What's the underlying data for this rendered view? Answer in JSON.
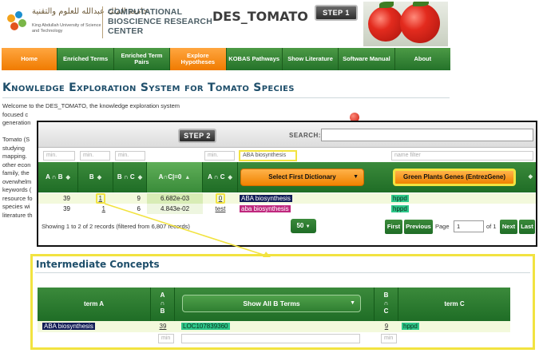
{
  "header": {
    "university_ar": "جامعة الملك عبدالله للعلوم والتقنية",
    "university_en": "King Abdullah University of Science and Technology",
    "center_line1": "COMPUTATIONAL",
    "center_line2": "BIOSCIENCE RESEARCH",
    "center_line3": "CENTER",
    "app_title": "DES_TOMATO",
    "step1_label": "STEP 1"
  },
  "nav": {
    "items": [
      {
        "label": "Home"
      },
      {
        "label": "Enriched Terms"
      },
      {
        "label": "Enriched Term Pairs"
      },
      {
        "label": "Explore Hypotheses"
      },
      {
        "label": "KOBAS Pathways"
      },
      {
        "label": "Show Literature"
      },
      {
        "label": "Software Manual"
      },
      {
        "label": "About"
      }
    ]
  },
  "page": {
    "heading": "Knowledge Exploration System for Tomato Species",
    "intro_lines": [
      "Welcome to the DES_TOMATO, the knowledge exploration system",
      "focused c",
      "generation",
      "",
      "Tomato (S",
      "studying",
      "mapping.",
      "other econ",
      "family, the",
      "overwhelm",
      "keywords (",
      "resource fo",
      "species wi",
      "literature th"
    ]
  },
  "step2": {
    "step_label": "STEP 2",
    "search_label": "SEARCH:",
    "search_value": "",
    "filters": {
      "min1": "min.",
      "min2": "min.",
      "min3": "min.",
      "min4": "min.",
      "term_filter": "ABA biosynthesis",
      "name_filter": "name filter"
    },
    "columns": {
      "a_and_b": "A ∩ B",
      "b": "B",
      "b_and_c": "B ∩ C",
      "a_c_zero": "A∩C|=0",
      "a_and_c": "A ∩ C",
      "dict1": "Select First Dictionary",
      "dict2": "Green Plants Genes (EntrezGene)"
    },
    "rows": [
      {
        "a_and_b": "39",
        "b": "1",
        "b_and_c": "9",
        "pvalue": "6.682e-03",
        "a_and_c": "0",
        "term_a": "ABA biosynthesis",
        "term_c": "hppd"
      },
      {
        "a_and_b": "39",
        "b": "1",
        "b_and_c": "6",
        "pvalue": "4.843e-02",
        "a_and_c": "test",
        "term_a": "aba biosynthesis",
        "term_c": "hppd"
      }
    ],
    "showing_text": "Showing 1 to 2 of 2 records (filtered from 6,807 records)",
    "per_page": "50",
    "pager": {
      "first": "First",
      "previous": "Previous",
      "page_label": "Page",
      "page_value": "1",
      "of_label": "of 1",
      "next": "Next",
      "last": "Last"
    }
  },
  "intermediate": {
    "title": "Intermediate Concepts",
    "columns": {
      "term_a": "term A",
      "a_and_b": "A ∩ B",
      "show_all": "Show All B Terms",
      "b_and_c": "B ∩ C",
      "term_c": "term C"
    },
    "row": {
      "term_a": "ABA biosynthesis",
      "a_and_b": "39",
      "term_b": "LOC107839360",
      "b_and_c": "9",
      "term_c": "hppd"
    },
    "filters": {
      "min1": "min",
      "min2": "min"
    }
  },
  "colors": {
    "nav_green": "#2b7a2b",
    "accent_orange": "#f08300",
    "highlight_yellow": "#f2e340",
    "heading_blue": "#1f4f6b"
  }
}
